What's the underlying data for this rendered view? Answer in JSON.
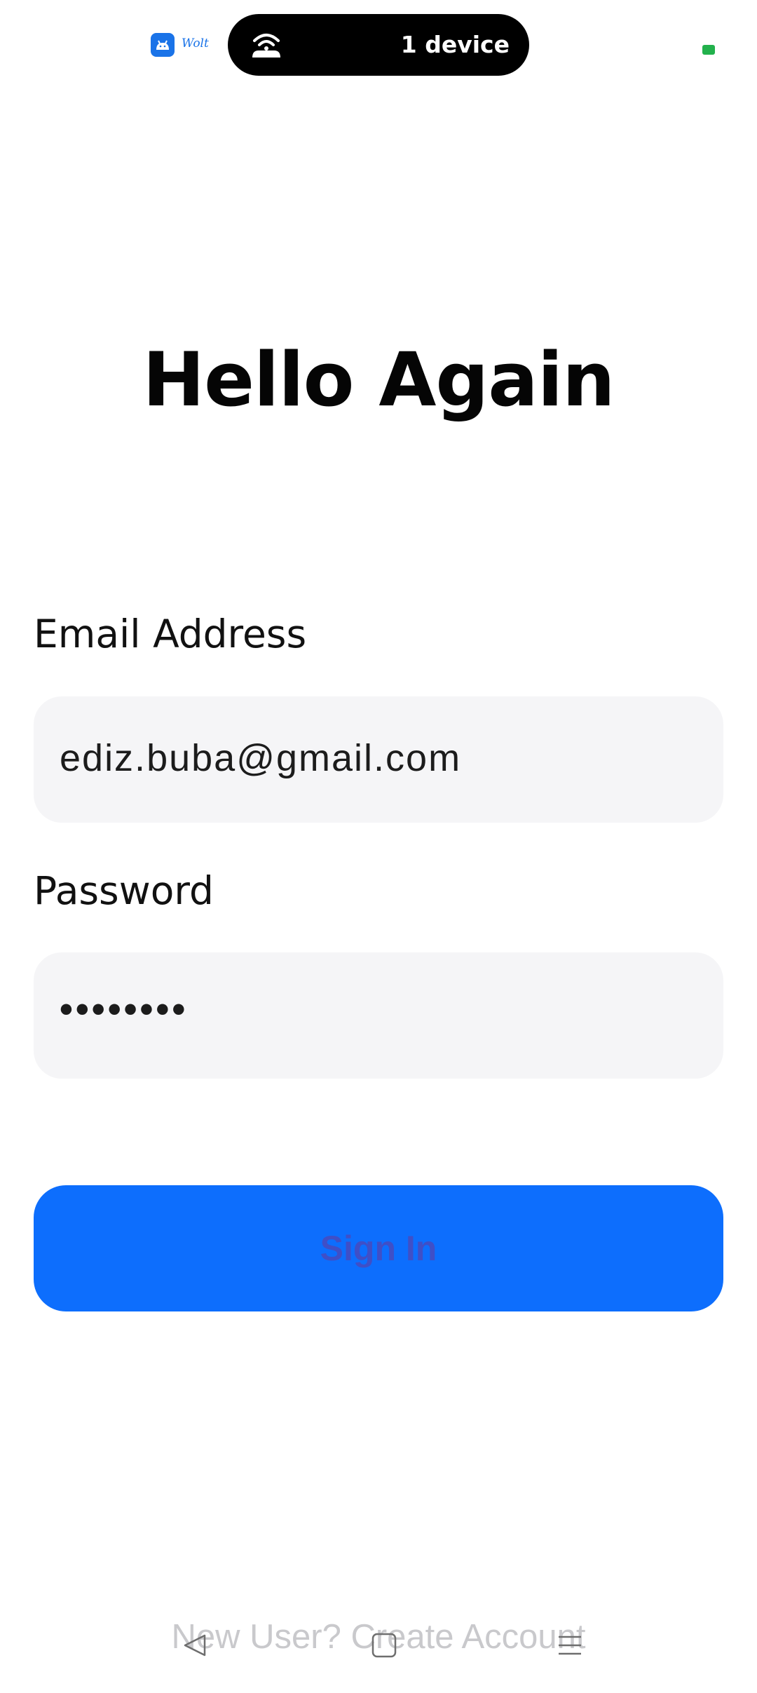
{
  "status_bar": {
    "app_badge_label": "Wolt",
    "hotspot_label": "1 device",
    "hotspot_icon": "hotspot-icon",
    "battery_color": "#22b14c"
  },
  "title": "Hello Again",
  "form": {
    "email_label": "Email Address",
    "email_value": "ediz.buba@gmail.com",
    "password_label": "Password",
    "password_value": "••••••••",
    "signin_label": "Sign In"
  },
  "footer": {
    "create_account_text": "New User? Create Account"
  },
  "nav": {
    "back_icon": "back-triangle-icon",
    "home_icon": "home-square-icon",
    "menu_icon": "menu-lines-icon"
  },
  "colors": {
    "accent": "#0d6efd",
    "field_bg": "#f5f5f7",
    "button_text": "#3f4fc7",
    "footer_text": "#c9c9cc"
  }
}
